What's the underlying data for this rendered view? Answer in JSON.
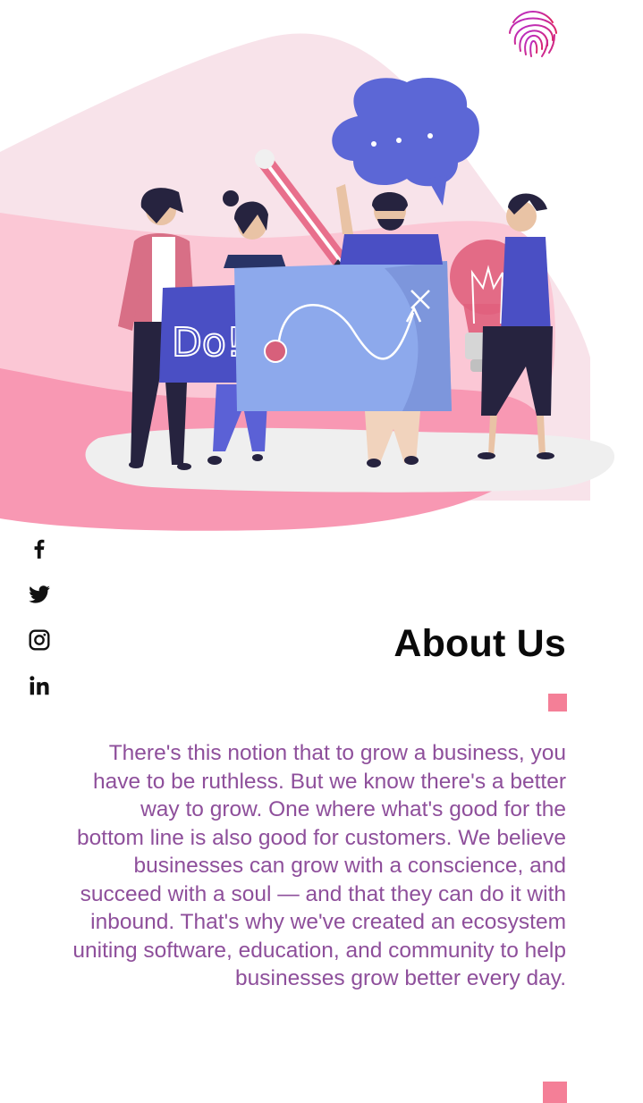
{
  "header": {
    "logo_icon": "fingerprint-icon"
  },
  "social": [
    {
      "name": "facebook",
      "icon": "facebook-icon"
    },
    {
      "name": "twitter",
      "icon": "twitter-icon"
    },
    {
      "name": "instagram",
      "icon": "instagram-icon"
    },
    {
      "name": "linkedin",
      "icon": "linkedin-icon"
    }
  ],
  "hero": {
    "sign_text": "Do!",
    "colors": {
      "blob_light": "#f8e3ea",
      "blob_mid": "#fbc4d3",
      "blob_strong": "#f898b3",
      "board": "#8da9ec",
      "bubble": "#5c67d6"
    }
  },
  "about": {
    "title": "About Us",
    "text": "There's this notion that to grow a business, you have to be ruthless. But we know there's a better way to grow. One where what's good for the bottom line is also good for customers. We believe businesses can grow with a conscience, and succeed with a soul — and that they can do it with inbound. That's why we've created an ecosystem uniting software, education, and community to help businesses grow better every day."
  },
  "colors": {
    "accent": "#f47f97",
    "text": "#8e4f9b",
    "heading": "#0a0a0a"
  }
}
